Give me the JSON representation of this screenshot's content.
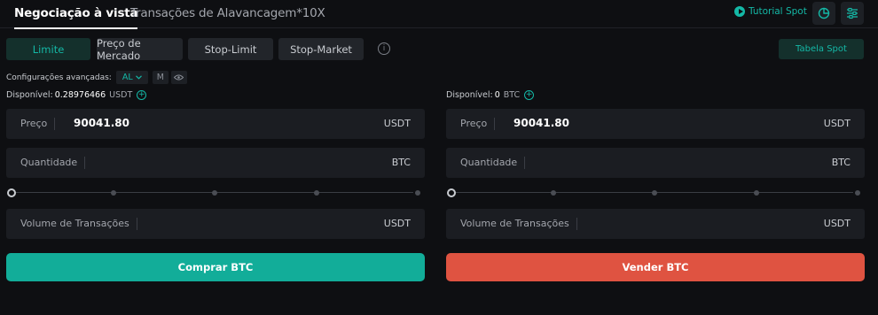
{
  "tabs": {
    "spot": "Negociação à vista",
    "leverage": "Transações de Alavancagem*10X"
  },
  "toolbar": {
    "tutorial_label": "Tutorial Spot",
    "icons": [
      "play-circle-icon",
      "pie-chart-icon",
      "sliders-icon"
    ]
  },
  "order_types": [
    "Limite",
    "Preço de Mercado",
    "Stop-Limit",
    "Stop-Market"
  ],
  "active_order_type": "Limite",
  "spot_table_label": "Tabela Spot",
  "advanced": {
    "label": "Configurações avançadas:",
    "al_value": "AL",
    "m_label": "M"
  },
  "buy": {
    "available_label": "Disponível:",
    "available_value": "0.28976466",
    "available_currency": "USDT",
    "price_label": "Preço",
    "price_value": "90041.80",
    "price_unit": "USDT",
    "quantity_label": "Quantidade",
    "quantity_unit": "BTC",
    "slider_percent": 0,
    "volume_label": "Volume de Transações",
    "volume_unit": "USDT",
    "button_label": "Comprar BTC"
  },
  "sell": {
    "available_label": "Disponível:",
    "available_value": "0",
    "available_currency": "BTC",
    "price_label": "Preço",
    "price_value": "90041.80",
    "price_unit": "USDT",
    "quantity_label": "Quantidade",
    "quantity_unit": "BTC",
    "slider_percent": 0,
    "volume_label": "Volume de Transações",
    "volume_unit": "USDT",
    "button_label": "Vender BTC"
  },
  "colors": {
    "accent": "#14b8a6",
    "buy": "#12ad99",
    "sell": "#df5341",
    "background": "#0e0f12"
  }
}
